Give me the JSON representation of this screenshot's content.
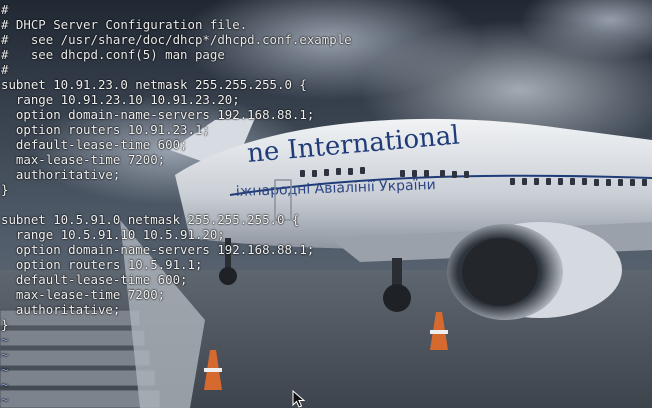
{
  "colors": {
    "text": "#f2f2f2",
    "tilde": "#7fa0d8",
    "sky_dark": "#28313d",
    "sky_light": "#8e98a6",
    "fuselage": "#dfe3e8",
    "livery_blue": "#1f3b78"
  },
  "wallpaper": {
    "livery_text": "ne International",
    "livery_subtext": "іжнародні  Авіалінії  України"
  },
  "editor": {
    "lines": [
      {
        "text": "#",
        "kind": "comment"
      },
      {
        "text": "# DHCP Server Configuration file.",
        "kind": "comment"
      },
      {
        "text": "#   see /usr/share/doc/dhcp*/dhcpd.conf.example",
        "kind": "comment"
      },
      {
        "text": "#   see dhcpd.conf(5) man page",
        "kind": "comment"
      },
      {
        "text": "#",
        "kind": "comment"
      },
      {
        "text": "subnet 10.91.23.0 netmask 255.255.255.0 {",
        "kind": "code"
      },
      {
        "text": "  range 10.91.23.10 10.91.23.20;",
        "kind": "code"
      },
      {
        "text": "  option domain-name-servers 192.168.88.1;",
        "kind": "code"
      },
      {
        "text": "  option routers 10.91.23.1;",
        "kind": "code"
      },
      {
        "text": "  default-lease-time 600;",
        "kind": "code"
      },
      {
        "text": "  max-lease-time 7200;",
        "kind": "code"
      },
      {
        "text": "  authoritative;",
        "kind": "code"
      },
      {
        "text": "}",
        "kind": "code"
      },
      {
        "text": "",
        "kind": "code"
      },
      {
        "text": "subnet 10.5.91.0 netmask 255.255.255.0 {",
        "kind": "code"
      },
      {
        "text": "  range 10.5.91.10 10.5.91.20;",
        "kind": "code"
      },
      {
        "text": "  option domain-name-servers 192.168.88.1;",
        "kind": "code"
      },
      {
        "text": "  option routers 10.5.91.1;",
        "kind": "code"
      },
      {
        "text": "  default-lease-time 600;",
        "kind": "code"
      },
      {
        "text": "  max-lease-time 7200;",
        "kind": "code"
      },
      {
        "text": "  authoritative;",
        "kind": "code"
      },
      {
        "text": "}",
        "kind": "code"
      },
      {
        "text": "~",
        "kind": "tilde"
      },
      {
        "text": "~",
        "kind": "tilde"
      },
      {
        "text": "~",
        "kind": "tilde"
      },
      {
        "text": "~",
        "kind": "tilde"
      },
      {
        "text": "~",
        "kind": "tilde"
      }
    ]
  },
  "pointer": {
    "icon": "arrow-cursor-icon"
  }
}
